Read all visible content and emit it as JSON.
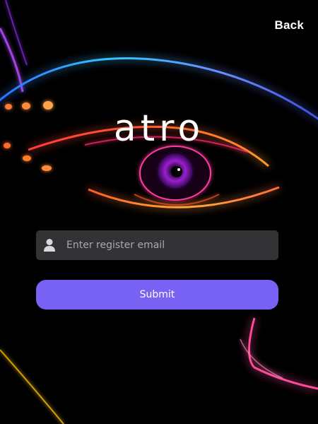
{
  "header": {
    "back_label": "Back"
  },
  "brand": {
    "logo_text": "atro"
  },
  "form": {
    "email_placeholder": "Enter register email",
    "email_value": "",
    "submit_label": "Submit"
  },
  "icons": {
    "email_field_icon": "user-icon"
  },
  "colors": {
    "background": "#000000",
    "accent": "#7862f3",
    "input_background": "#333336",
    "placeholder": "#a9a9ad"
  }
}
